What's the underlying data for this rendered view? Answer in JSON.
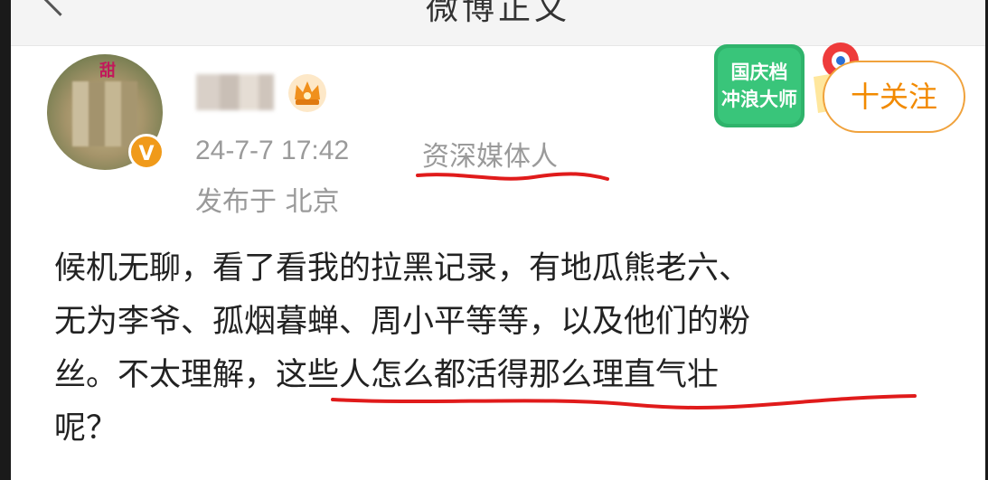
{
  "header": {
    "title": "微博正文"
  },
  "post": {
    "avatar_tag": "甜",
    "verified_symbol": "V",
    "time": "24-7-7 17:42",
    "user_label": "资深媒体人",
    "location": "发布于 北京",
    "badge_line1": "国庆档",
    "badge_line2": "冲浪大师",
    "follow_label": "十关注",
    "body_lines": [
      "候机无聊，看了看我的拉黑记录，有地瓜熊老六、",
      "无为李爷、孤烟暮蝉、周小平等等，以及他们的粉",
      "丝。不太理解，这些人怎么都活得那么理直气壮",
      "呢？"
    ]
  },
  "colors": {
    "accent": "#f28a00",
    "underline": "#e01b1b",
    "meta_text": "#9a9a9a",
    "body_text": "#222222"
  },
  "icons": [
    "back-arrow-icon",
    "crown-icon",
    "verified-badge-icon"
  ]
}
